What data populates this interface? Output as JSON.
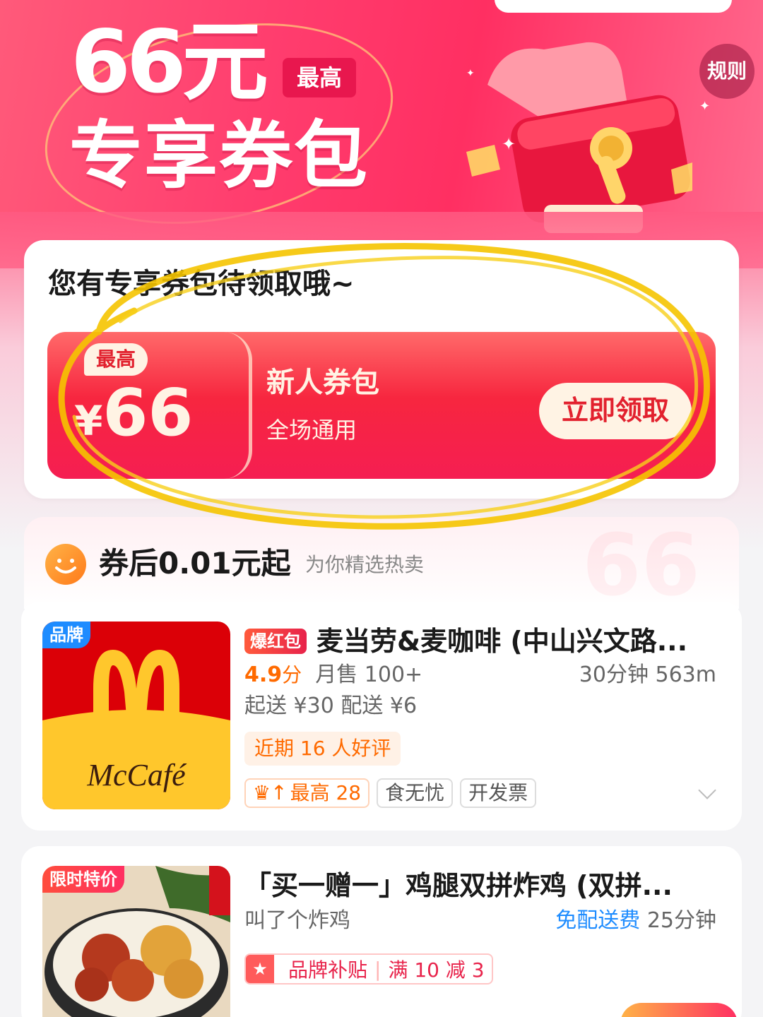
{
  "hero": {
    "big_title": "66元",
    "max_tag": "最高",
    "subtitle": "专享券包",
    "rules_label": "规则"
  },
  "coupon": {
    "heading": "您有专享券包待领取哦~",
    "max_label": "最高",
    "currency": "¥",
    "amount": "66",
    "title": "新人券包",
    "desc": "全场通用",
    "claim_label": "立即领取"
  },
  "section": {
    "title": "券后0.01元起",
    "subtitle": "为你精选热卖"
  },
  "stores": [
    {
      "badge": "品牌",
      "hot_tag": "爆红包",
      "name": "麦当劳&麦咖啡 (中山兴文路...",
      "rating": "4.9",
      "rating_unit": "分",
      "monthly_sales": "月售 100+",
      "eta_distance": "30分钟 563m",
      "min_delivery": "起送 ¥30  配送 ¥6",
      "review_chip": "近期 16 人好评",
      "tags": [
        "最高 28",
        "食无忧",
        "开发票"
      ],
      "logo_text": "McCafé"
    },
    {
      "badge": "限时特价",
      "name": "「买一赠一」鸡腿双拼炸鸡 (双拼...",
      "shop": "叫了个炸鸡",
      "free_delivery": "免配送费",
      "eta": "25分钟",
      "subsidy_label": "品牌补贴",
      "subsidy_deal": "满 10 减 3"
    }
  ],
  "colors": {
    "hero_pink": "#ff3d6e",
    "coupon_red": "#f7263f",
    "accent_orange": "#ff6a00",
    "link_blue": "#1e8cff",
    "mcd_red": "#db0007",
    "mcd_yellow": "#ffc72c"
  }
}
